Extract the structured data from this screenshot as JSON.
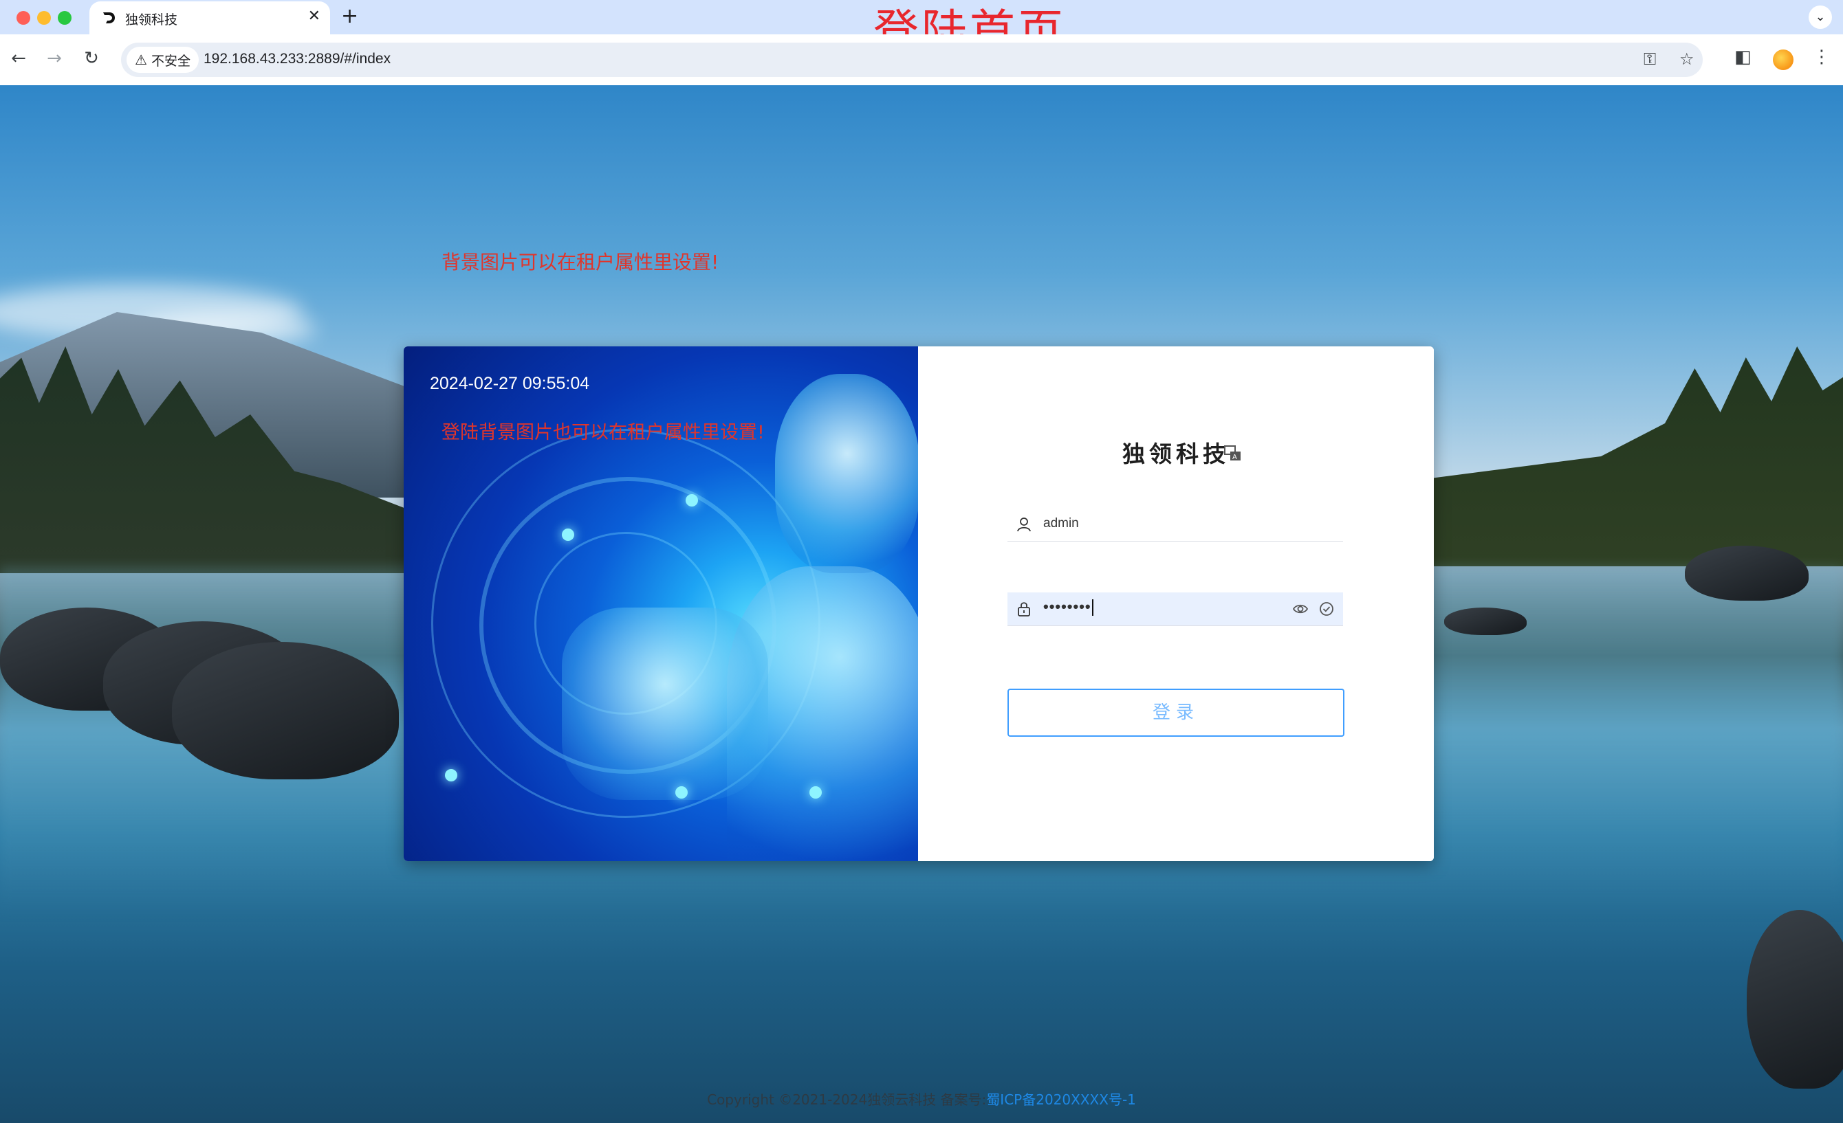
{
  "browser": {
    "tab_title": "独领科技",
    "security_label": "不安全",
    "url": "192.168.43.233:2889/#/index"
  },
  "overlay_title": "登陆首页",
  "notes": {
    "background_note": "背景图片可以在租户属性里设置!",
    "card_note": "登陆背景图片也可以在租户属性里设置!"
  },
  "login": {
    "datetime": "2024-02-27 09:55:04",
    "brand": "独领科技",
    "username": "admin",
    "password_mask": "••••••••",
    "button_label": "登录"
  },
  "footer": {
    "copyright": "Copyright ©2021-2024独领云科技 备案号:",
    "icp": "蜀ICP备2020XXXX号-1"
  },
  "colors": {
    "accent": "#409eff",
    "note_red": "#e0352b",
    "overlay_red": "#e8262d"
  }
}
